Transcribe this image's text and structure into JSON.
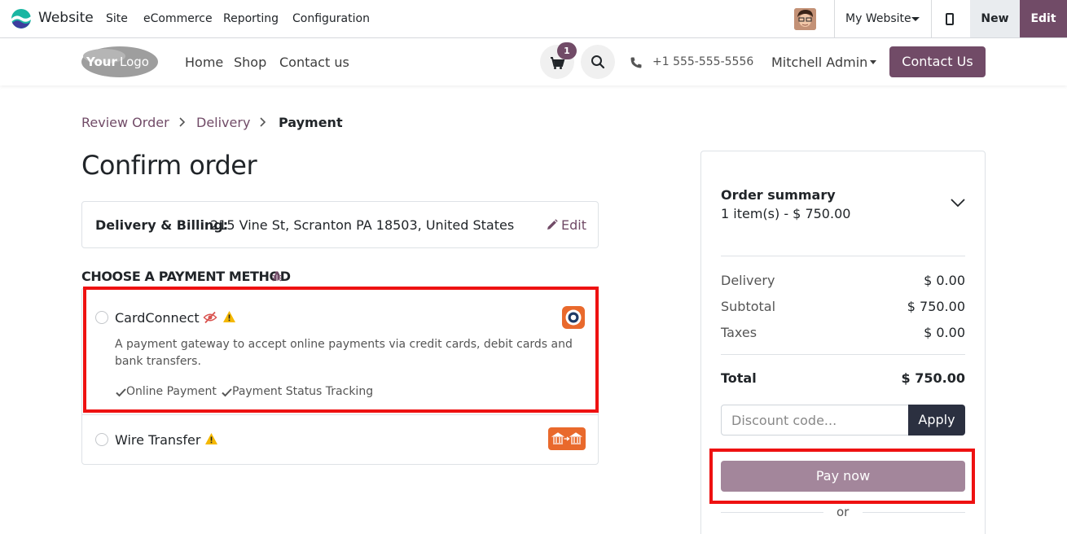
{
  "admin_bar": {
    "app_name": "Website",
    "menu": [
      "Site",
      "eCommerce",
      "Reporting",
      "Configuration"
    ],
    "website_selector": "My Website",
    "new_label": "New",
    "edit_label": "Edit"
  },
  "header": {
    "nav": [
      "Home",
      "Shop",
      "Contact us"
    ],
    "cart_count": "1",
    "phone": "+1 555-555-5556",
    "user": "Mitchell Admin",
    "contact_button": "Contact Us"
  },
  "breadcrumb": [
    "Review Order",
    "Delivery",
    "Payment"
  ],
  "page_title": "Confirm order",
  "address": {
    "label": "Delivery & Billing:",
    "text": "215 Vine St, Scranton PA 18503, United States",
    "edit": "Edit"
  },
  "payment_heading": "CHOOSE A PAYMENT METHOD",
  "payment_methods": [
    {
      "name": "CardConnect",
      "description": "A payment gateway to accept online payments via credit cards, debit cards and bank transfers.",
      "features": [
        "Online Payment",
        "Payment Status Tracking"
      ]
    },
    {
      "name": "Wire Transfer"
    }
  ],
  "summary": {
    "title": "Order summary",
    "items": "1 item(s) -  $ 750.00",
    "rows": [
      {
        "label": "Delivery",
        "value": "$ 0.00"
      },
      {
        "label": "Subtotal",
        "value": "$ 750.00"
      },
      {
        "label": "Taxes",
        "value": "$ 0.00"
      }
    ],
    "total_label": "Total",
    "total_value": "$ 750.00",
    "discount_placeholder": "Discount code...",
    "apply_label": "Apply",
    "pay_label": "Pay now",
    "or_label": "or"
  },
  "colors": {
    "brand": "#714b67",
    "highlight": "#ee1111",
    "warning": "#f5b800",
    "provider_orange": "#e9692c"
  }
}
